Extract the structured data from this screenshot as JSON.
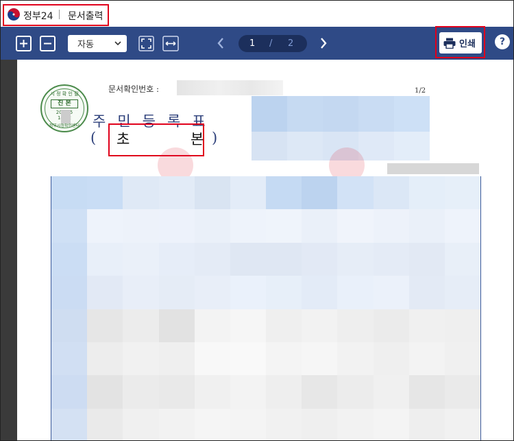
{
  "window": {
    "app_title": "정부24",
    "doc_title": "문서출력"
  },
  "toolbar": {
    "zoom_value": "자동",
    "current_page": "1",
    "page_separator": "/",
    "total_pages": "2",
    "print_label": "인쇄",
    "help_label": "?"
  },
  "document": {
    "doc_number_label": "문서확인번호 :",
    "page_indicator": "1/2",
    "seal": {
      "top": "시 정 확 인 필",
      "center": "진 본",
      "date_line1": "202 25",
      "date_line2": "14 02",
      "bottom": "정부시정확인센터"
    },
    "title_line1": "주민등록표",
    "paren_open": "(",
    "paren_close": ")",
    "subtitle_char1": "초",
    "subtitle_char2": "본"
  },
  "colors": {
    "toolbar_bg": "#2f4a86",
    "pager_bg": "#1c2f5c",
    "highlight": "#e0001b",
    "title_blue": "#2c3f7a"
  }
}
